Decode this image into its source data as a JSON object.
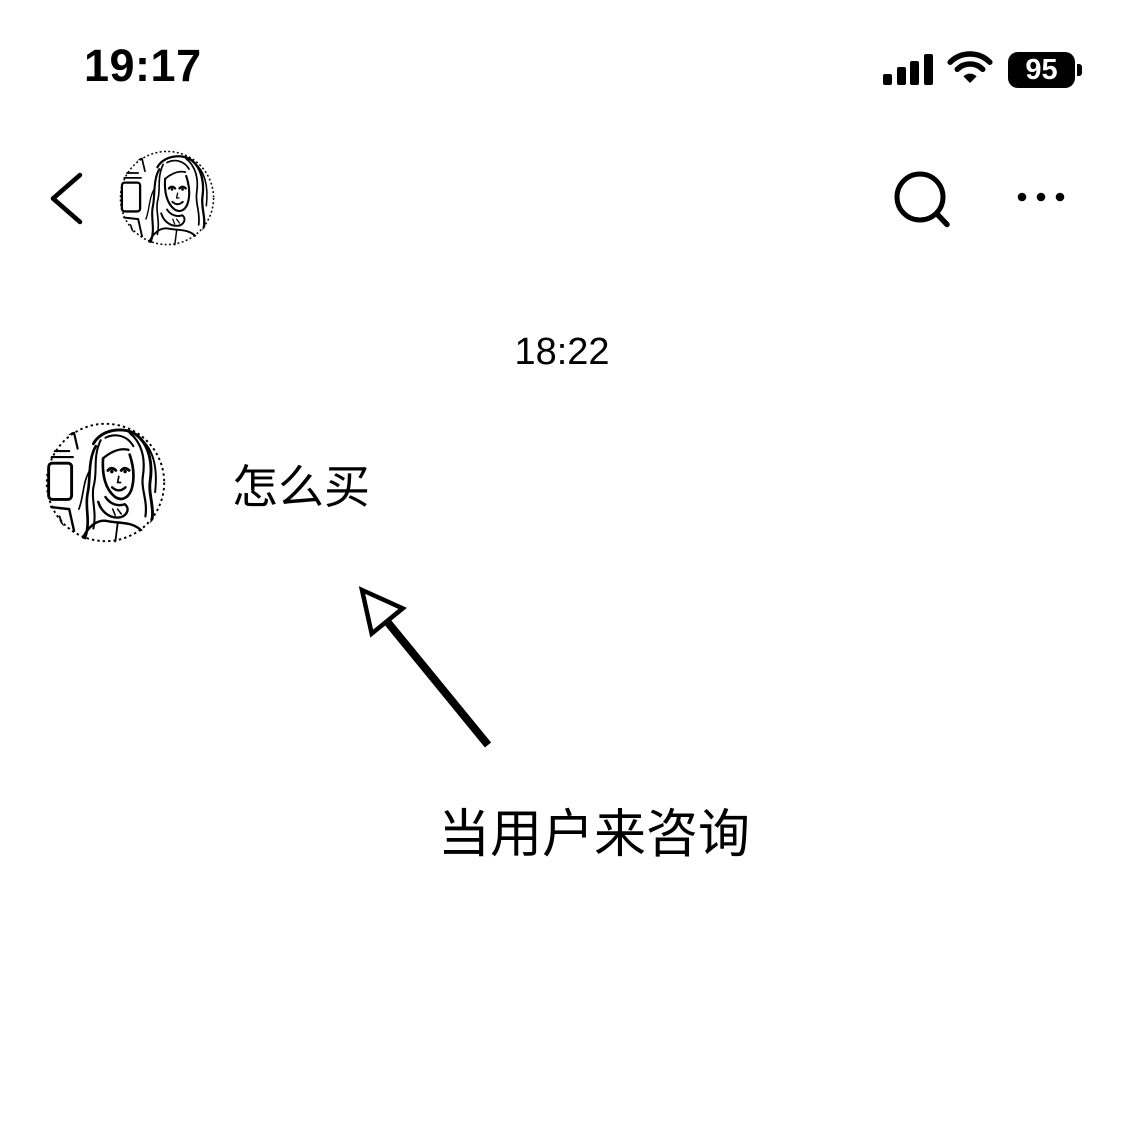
{
  "status_bar": {
    "time": "19:17",
    "battery": "95",
    "signal_bars": 4,
    "signal_bars_max": 4,
    "icons": {
      "signal": "signal-strength-icon",
      "wifi": "wifi-icon",
      "battery": "battery-icon"
    }
  },
  "header": {
    "icons": {
      "back": "chevron-left-icon",
      "search": "search-icon",
      "more": "more-dots-icon"
    }
  },
  "chat": {
    "timestamp": "18:22",
    "messages": [
      {
        "text": "怎么买"
      }
    ]
  },
  "annotation": {
    "text": "当用户来咨询",
    "icon": "arrow-up-left-icon"
  },
  "colors": {
    "background": "#ffffff",
    "foreground": "#000000"
  }
}
